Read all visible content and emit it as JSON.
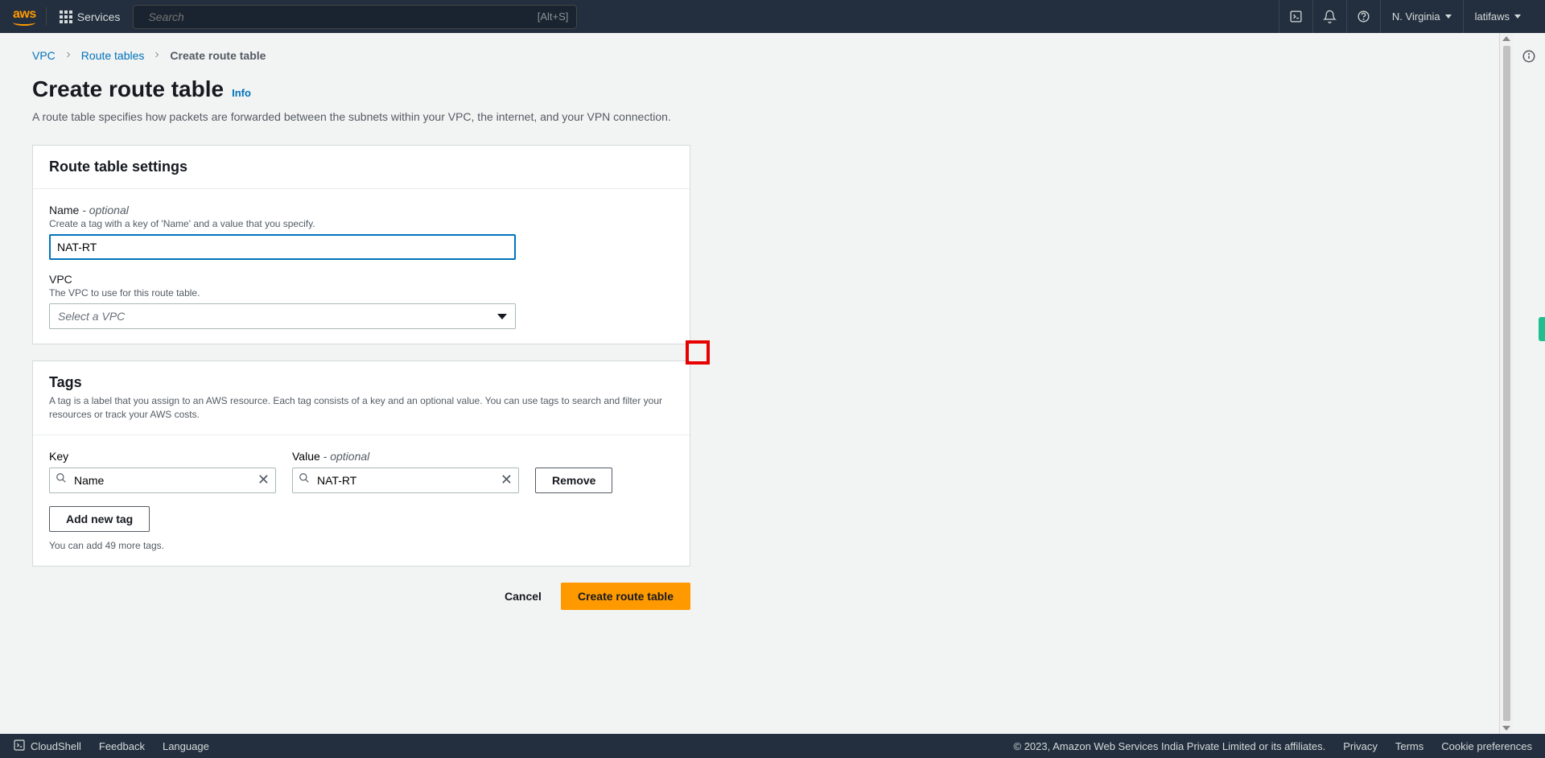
{
  "topnav": {
    "logo_text": "aws",
    "services_label": "Services",
    "search_placeholder": "Search",
    "search_shortcut": "[Alt+S]",
    "region": "N. Virginia",
    "user": "latifaws"
  },
  "breadcrumbs": {
    "items": [
      "VPC",
      "Route tables",
      "Create route table"
    ]
  },
  "page": {
    "title": "Create route table",
    "info_link": "Info",
    "description": "A route table specifies how packets are forwarded between the subnets within your VPC, the internet, and your VPN connection."
  },
  "settings_panel": {
    "title": "Route table settings",
    "name_label": "Name",
    "name_optional": " - optional",
    "name_hint": "Create a tag with a key of 'Name' and a value that you specify.",
    "name_value": "NAT-RT",
    "vpc_label": "VPC",
    "vpc_hint": "The VPC to use for this route table.",
    "vpc_placeholder": "Select a VPC"
  },
  "tags_panel": {
    "title": "Tags",
    "description": "A tag is a label that you assign to an AWS resource. Each tag consists of a key and an optional value. You can use tags to search and filter your resources or track your AWS costs.",
    "key_header": "Key",
    "value_header": "Value",
    "value_optional": " - optional",
    "rows": [
      {
        "key": "Name",
        "value": "NAT-RT"
      }
    ],
    "remove_label": "Remove",
    "add_label": "Add new tag",
    "limit_text": "You can add 49 more tags."
  },
  "actions": {
    "cancel": "Cancel",
    "create": "Create route table"
  },
  "footer": {
    "cloudshell": "CloudShell",
    "feedback": "Feedback",
    "language": "Language",
    "copyright": "© 2023, Amazon Web Services India Private Limited or its affiliates.",
    "privacy": "Privacy",
    "terms": "Terms",
    "cookies": "Cookie preferences"
  }
}
